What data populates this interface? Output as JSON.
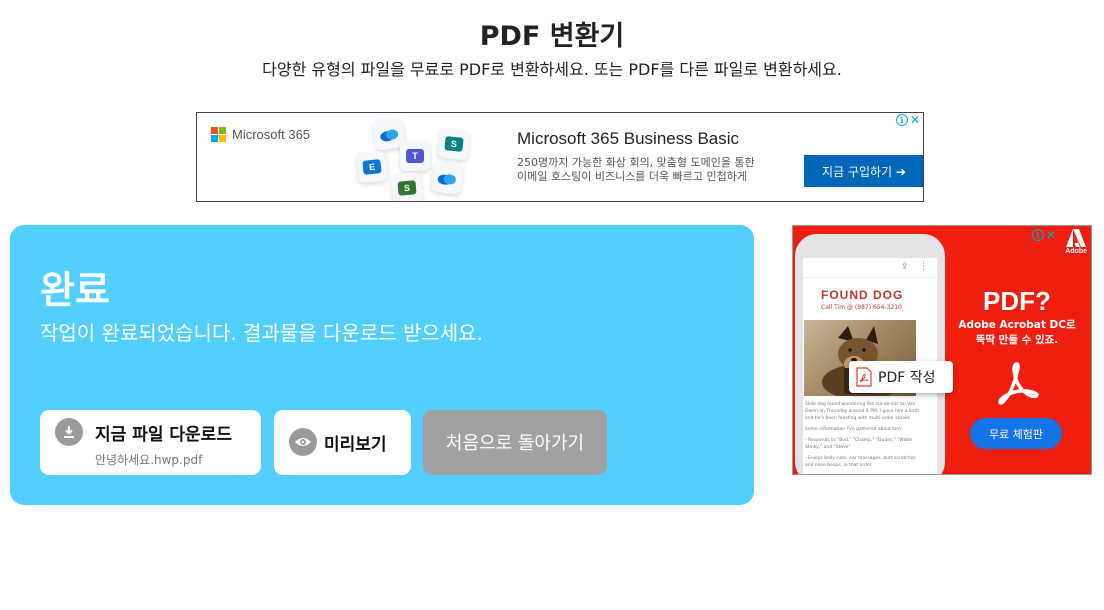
{
  "header": {
    "title": "PDF 변환기",
    "subtitle": "다양한 유형의 파일을 무료로 PDF로 변환하세요. 또는 PDF를 다른 파일로 변환하세요."
  },
  "top_ad": {
    "brand": "Microsoft 365",
    "headline": "Microsoft 365 Business Basic",
    "description_line1": "250명까지 가능한 화상 회의, 맞춤형 도메인을 통한",
    "description_line2": "이메일 호스팅이 비즈니스를 더욱 빠르고 민첩하게",
    "cta": "지금 구입하기 ➔",
    "app_icons": [
      "onedrive-icon",
      "teams-icon",
      "exchange-icon",
      "sharepoint-icon",
      "planner-icon"
    ]
  },
  "result": {
    "title": "완료",
    "message": "작업이 완료되었습니다. 결과물을 다운로드 받으세요.",
    "download_label": "지금 파일 다운로드",
    "download_filename": "안녕하세요.hwp.pdf",
    "preview_label": "미리보기",
    "back_label": "처음으로 돌아가기"
  },
  "side_ad": {
    "found_dog": "FOUND DOG",
    "call_line": "Call Tim @ (987) 654-3210",
    "story_p1": "Slide dog found wandering the cul-de-sac on Van Owen on Thursday around 4 PM. I gave him a bath and he's been feasting with multi-order steaks.",
    "story_p2": "Some information I've gathered about him:",
    "story_p3": "- Responds to \"Bud,\" \"Champ,\" \"Dudes,\" \"Water Stinky,\" and \"Steve\"",
    "story_p4": "- Enjoys belly rubs, ear massages, butt scratches and nose boops, in that order.",
    "pdf_chip": "PDF 작성",
    "headline": "PDF?",
    "desc_line1": "Adobe Acrobat DC로",
    "desc_line2": "뚝딱 만들 수 있죠.",
    "cta": "무료 체험판",
    "logo_text": "Adobe"
  },
  "colors": {
    "panel": "#52cfff",
    "back_button": "#9fa1a3",
    "ms_blue": "#0067b8",
    "adobe_red": "#ee1e10",
    "adobe_blue": "#1473e6"
  }
}
